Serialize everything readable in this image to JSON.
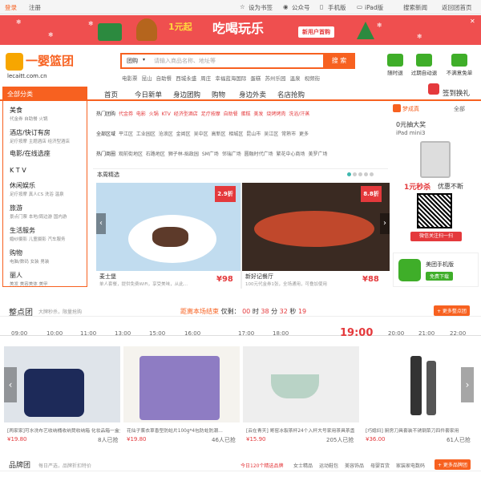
{
  "topbar": {
    "login": "登录",
    "register": "注册",
    "bookmark": "设为书签",
    "wechat": "公众号",
    "mobile": "手机版",
    "ipad": "iPad版",
    "news": "搜索新闻",
    "back_home": "返回团首页"
  },
  "banner": {
    "prefix": "1元起",
    "title": "吃喝玩乐",
    "cta": "新用户首购"
  },
  "logo": {
    "name": "一婴篮团",
    "domain": "lecaitt.com.cn"
  },
  "search": {
    "scope": "团购",
    "placeholder": "请输入商品名称、地址等",
    "button": "搜 索",
    "hotwords": "电影票 昆山 自助餐 西城永盛 周庄 幸福蓝海国际 蛋糕 苏州乐园 温泉 视频街"
  },
  "services": [
    {
      "label": "随时退"
    },
    {
      "label": "过期自动退"
    },
    {
      "label": "不满意免单"
    }
  ],
  "nav": {
    "all_categories": "全部分类",
    "items": [
      "首页",
      "今日新单",
      "身边团购",
      "购物",
      "身边外卖",
      "名店抢购"
    ],
    "sign_in": "签到换礼"
  },
  "categories": [
    {
      "name": "美食",
      "sub": "代金券  自助餐  火锅"
    },
    {
      "name": "酒店/快订有房",
      "sub": "足疗按摩  主题酒店  经济型酒店"
    },
    {
      "name": "电影/在线选座",
      "sub": ""
    },
    {
      "name": "K T V",
      "sub": ""
    },
    {
      "name": "休闲娱乐",
      "sub": "足疗按摩  真人CS  洗浴  温泉"
    },
    {
      "name": "旅游",
      "sub": "景点门票  本地/周边游  国内游"
    },
    {
      "name": "生活服务",
      "sub": "婚纱摄影  儿童摄影  汽车服务"
    },
    {
      "name": "购物",
      "sub": "电脑/数码  女装  男装"
    },
    {
      "name": "丽人",
      "sub": "美发  美容美体  美甲"
    }
  ],
  "filters": {
    "row1_label": "热门团购",
    "row1": "代金券  电影  火锅  KTV  经济型酒店  足疗按摩  自助餐  蛋糕  美发  烧烤烤肉  洗浴/汗蒸",
    "row2_label": "全部区域",
    "row2": "平江区  工业园区  沧浪区  金阊区  吴中区  高新区  相城区  昆山市  吴江区  常熟市  更多",
    "row3_label": "热门商圈",
    "row3": "观前街地区  石路地区  狮子林-拙政园  SM广场  邻瑞广场  圆融时代广场  繁花中心商场  美罗广场"
  },
  "weekly": {
    "title": "本周精选",
    "cards": [
      {
        "name": "麦士堡",
        "desc": "单人套餐，提供免费WiFi，享受美味，从此…",
        "price": "¥98",
        "badge": "2.9折"
      },
      {
        "name": "新好记餐厅",
        "desc": "100元代金券1张，全场通用，可叠加使用",
        "price": "¥88",
        "badge": "8.8折"
      }
    ]
  },
  "right_col": {
    "lottery": "梦成真",
    "all": "全部",
    "prize": "0元抽大奖",
    "prize_item": "iPad mini3",
    "flash": "1元秒杀",
    "flash_sub": "优惠不断",
    "wechat_follow": "微信关注扫一扫",
    "app_title": "美团手机版",
    "app_download": "免费下载"
  },
  "countdown": {
    "title": "整点团",
    "subtitle": "大牌秒杀，限量抢购",
    "prefix": "距离本场结束",
    "label": "仅剩：",
    "days": "00",
    "days_label": "时",
    "hours": "38",
    "hours_label": "分",
    "minutes": "32",
    "minutes_label": "秒",
    "seconds": "19",
    "more": "+ 更多整点团",
    "times": [
      "09:00",
      "10:00",
      "11:00",
      "13:00",
      "15:00",
      "16:00",
      "17:00",
      "18:00",
      "19:00",
      "20:00",
      "21:00",
      "22:00"
    ],
    "current": "19:00"
  },
  "products": [
    {
      "desc": "[两家家]可水洗布艺收纳桶收纳凳收纳箱 化妆品箱一盒多物件收纳…",
      "price": "¥19.80",
      "sold": "8人已抢"
    },
    {
      "desc": "花仙子薰衣草香型防蛀片100g*4包防蛀防潮…",
      "price": "¥19.80",
      "sold": "46人已抢"
    },
    {
      "desc": "[云在青天] 哥窑冰裂茶杯24个入杯大号家用茶具茶盏",
      "price": "¥15.90",
      "sold": "205人已抢"
    },
    {
      "desc": "[巧媳妇] 厨房刀具套装不锈钢菜刀四件套家用",
      "price": "¥36.00",
      "sold": "61人已抢"
    }
  ],
  "brand": {
    "title": "品牌团",
    "subtitle": "每日严选，品牌折扣特价",
    "count": "今日120个精选品牌",
    "tabs": [
      "女士精品",
      "运动鞋包",
      "美容饰品",
      "母婴百货",
      "家装家电数码"
    ],
    "more": "+ 更多品牌团"
  },
  "colors": {
    "accent": "#f76120",
    "red": "#e4393c",
    "banner": "#ef4f4f"
  }
}
